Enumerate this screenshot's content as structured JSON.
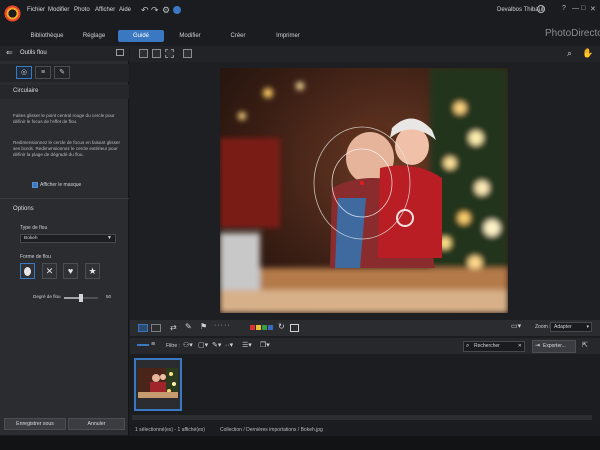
{
  "menu": [
    "Fichier",
    "Modifier",
    "Photo",
    "Afficher",
    "Aide"
  ],
  "user": "Devalbos Thibault",
  "window_controls": [
    "?",
    "—",
    "□",
    "✕"
  ],
  "tabs": [
    {
      "label": "Bibliothèque",
      "active": false
    },
    {
      "label": "Réglage",
      "active": false
    },
    {
      "label": "Guidé",
      "active": true
    },
    {
      "label": "Modifier",
      "active": false
    },
    {
      "label": "Créer",
      "active": false
    },
    {
      "label": "Imprimer",
      "active": false
    }
  ],
  "brand": "PhotoDirector",
  "panel": {
    "title": "Outils flou",
    "section1_title": "Circulaire",
    "para1": "Faites glisser le point central rouge du cercle pour définir le focus de l'effet de flou.",
    "para2": "Redimensionnez le cercle de focus en faisant glisser ses bords. Redimensionnez le cercle extérieur pour définir la plage de dégradé du flou.",
    "show_mask_label": "Afficher le masque",
    "options_title": "Options",
    "blur_type_label": "Type de flou",
    "blur_type_value": "Bokeh",
    "blur_shape_label": "Forme de flou",
    "shapes": [
      "circle-shape",
      "x-shape",
      "heart-shape",
      "star-shape"
    ],
    "degree_label": "Degré de flou",
    "degree_value": "50",
    "degree_max": 100,
    "save_as": "Enregistrer sous",
    "cancel": "Annuler"
  },
  "viewer": {
    "zoom_label": "Zoom :",
    "zoom_value": "Adapter"
  },
  "filter": {
    "label": "Filtre :",
    "search_placeholder": "Rechercher",
    "export": "Exporter..."
  },
  "status": {
    "selection": "1 sélectionné(es) - 1 affiché(es)",
    "path": "Collection / Dernières importations / Bokeh.jpg"
  },
  "colors": {
    "accent": "#3a78c2",
    "panel_bg": "#2a2c30",
    "app_bg": "#1c1d20"
  }
}
